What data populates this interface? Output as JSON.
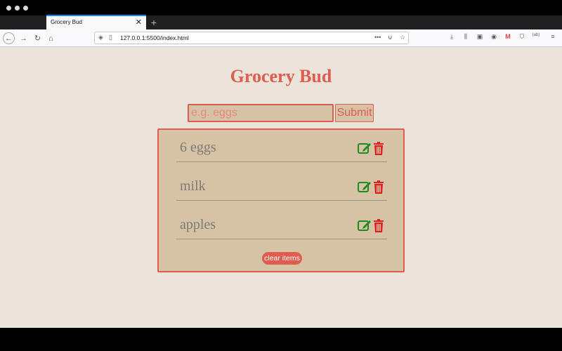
{
  "browser": {
    "tab_title": "Grocery Bud",
    "url": "127.0.0.1:5500/index.html"
  },
  "app": {
    "title": "Grocery Bud",
    "input_placeholder": "e.g. eggs",
    "input_value": "",
    "submit_label": "Submit",
    "clear_label": "clear items",
    "items": [
      {
        "name": "6 eggs"
      },
      {
        "name": "milk"
      },
      {
        "name": "apples"
      }
    ]
  },
  "colors": {
    "accent": "#e05c4e",
    "panel": "#d6c3a6",
    "background": "#eae4db",
    "edit_icon": "#1f8a1f",
    "delete_icon": "#e31c1c"
  }
}
